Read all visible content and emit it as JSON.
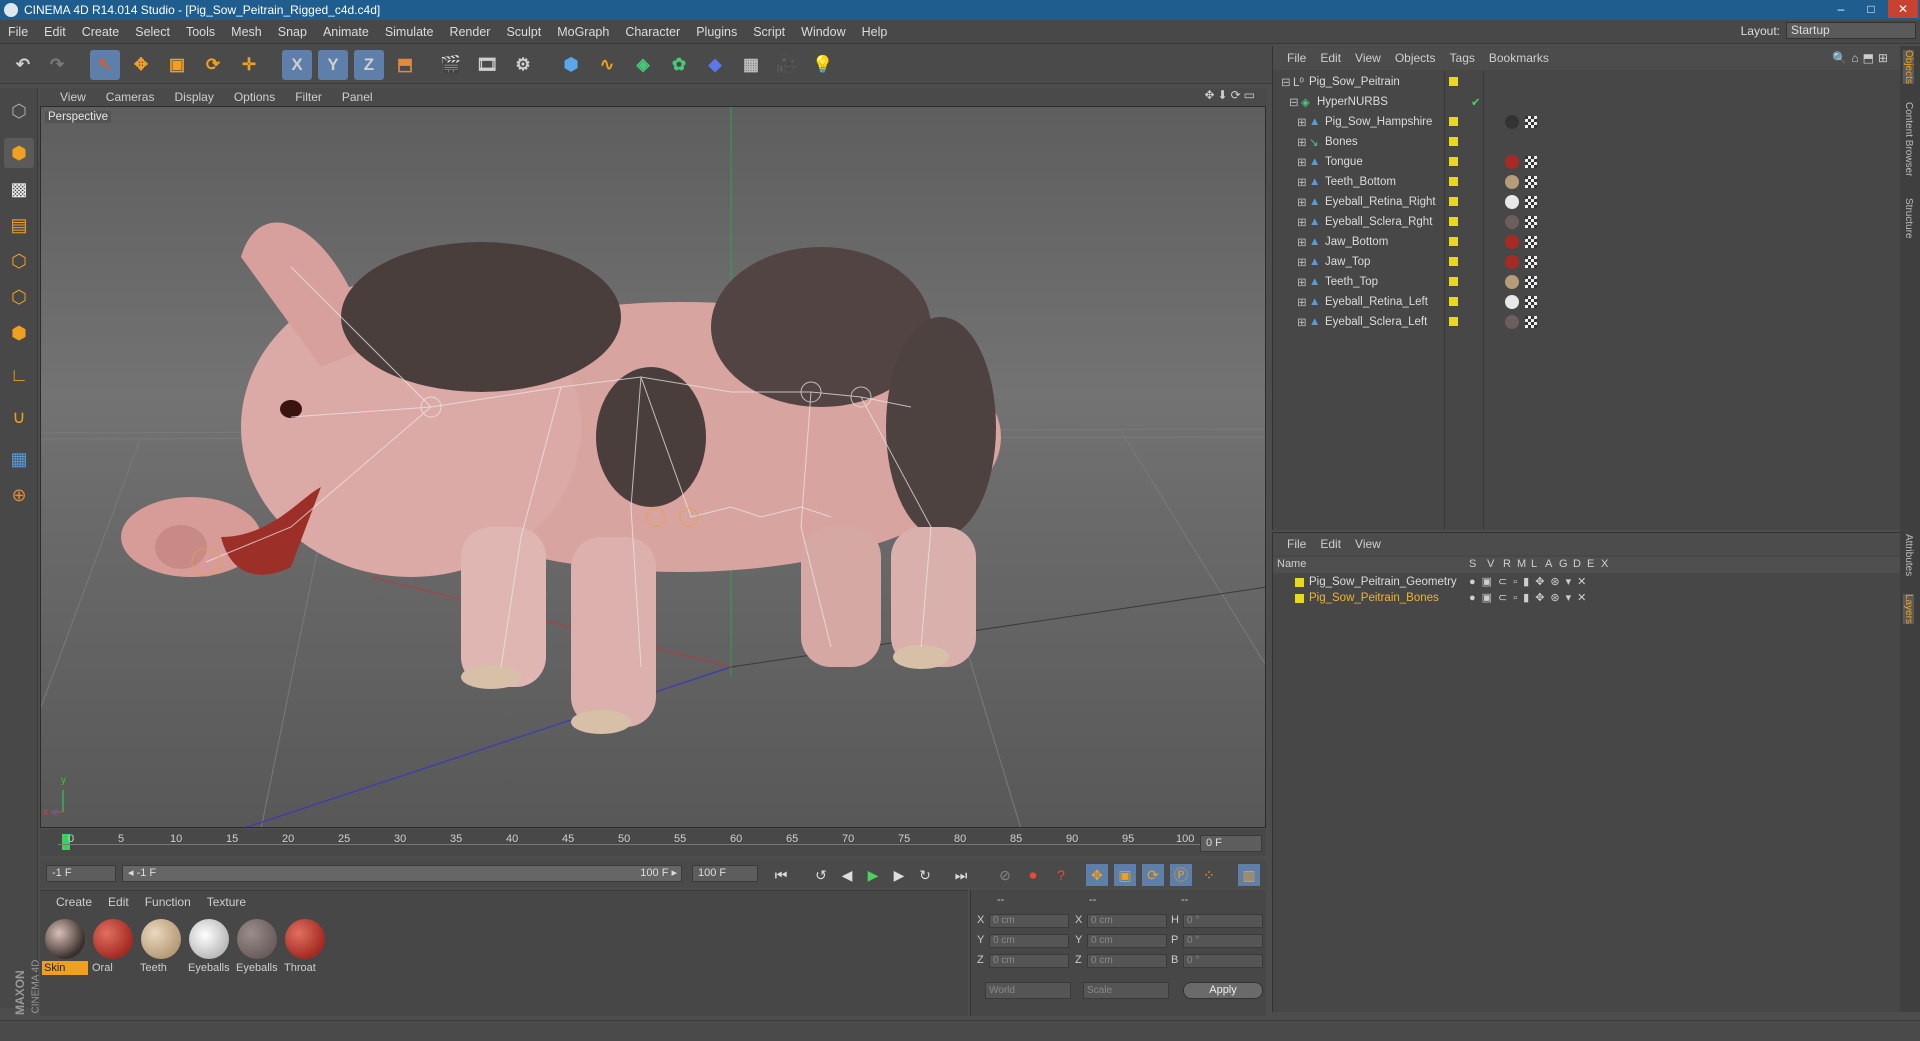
{
  "window": {
    "title": "CINEMA 4D R14.014 Studio - [Pig_Sow_Peitrain_Rigged_c4d.c4d]",
    "min": "–",
    "max": "□",
    "close": "✕"
  },
  "menu": [
    "File",
    "Edit",
    "Create",
    "Select",
    "Tools",
    "Mesh",
    "Snap",
    "Animate",
    "Simulate",
    "Render",
    "Sculpt",
    "MoGraph",
    "Character",
    "Plugins",
    "Script",
    "Window",
    "Help"
  ],
  "layout": {
    "label": "Layout:",
    "value": "Startup"
  },
  "toolbar": {
    "undo": "undo-icon",
    "redo": "redo-icon",
    "x": "X",
    "y": "Y",
    "z": "Z"
  },
  "viewport": {
    "menu": [
      "View",
      "Cameras",
      "Display",
      "Options",
      "Filter",
      "Panel"
    ],
    "label": "Perspective",
    "axes": {
      "x": "x",
      "y": "y",
      "z": "z"
    }
  },
  "timeline": {
    "ticks": [
      "0",
      "5",
      "10",
      "15",
      "20",
      "25",
      "30",
      "35",
      "40",
      "45",
      "50",
      "55",
      "60",
      "65",
      "70",
      "75",
      "80",
      "85",
      "90",
      "95",
      "100"
    ],
    "frame_field": "0 F"
  },
  "controls": {
    "start": "-1 F",
    "range_start": "◂ -1 F",
    "range_end": "100 F ▸",
    "end": "100 F"
  },
  "materials": {
    "menu": [
      "Create",
      "Edit",
      "Function",
      "Texture"
    ],
    "items": [
      {
        "name": "Skin",
        "color": "#3b2f2c",
        "selected": true
      },
      {
        "name": "Oral",
        "color": "#a52a23",
        "selected": false
      },
      {
        "name": "Teeth",
        "color": "#b79c79",
        "selected": false
      },
      {
        "name": "Eyeballs",
        "color": "#e8e8e8",
        "selected": false
      },
      {
        "name": "Eyeballs",
        "color": "#6b5e5c",
        "selected": false
      },
      {
        "name": "Throat",
        "color": "#a52a23",
        "selected": false
      }
    ],
    "brand_1": "MAXON",
    "brand_2": "CINEMA 4D"
  },
  "coords": {
    "headers": [
      "--",
      "--",
      "--"
    ],
    "rows": [
      {
        "a": "X",
        "av": "0 cm",
        "b": "X",
        "bv": "0 cm",
        "c": "H",
        "cv": "0 °"
      },
      {
        "a": "Y",
        "av": "0 cm",
        "b": "Y",
        "bv": "0 cm",
        "c": "P",
        "cv": "0 °"
      },
      {
        "a": "Z",
        "av": "0 cm",
        "b": "Z",
        "bv": "0 cm",
        "c": "B",
        "cv": "0 °"
      }
    ],
    "world": "World",
    "scale": "Scale",
    "apply": "Apply"
  },
  "objects": {
    "menu": [
      "File",
      "Edit",
      "View",
      "Objects",
      "Tags",
      "Bookmarks"
    ],
    "items": [
      {
        "name": "Pig_Sow_Peitrain",
        "indent": 0
      },
      {
        "name": "HyperNURBS",
        "indent": 1
      },
      {
        "name": "Pig_Sow_Hampshire",
        "indent": 2
      },
      {
        "name": "Bones",
        "indent": 2
      },
      {
        "name": "Tongue",
        "indent": 2
      },
      {
        "name": "Teeth_Bottom",
        "indent": 2
      },
      {
        "name": "Eyeball_Retina_Right",
        "indent": 2
      },
      {
        "name": "Eyeball_Sclera_Rght",
        "indent": 2
      },
      {
        "name": "Jaw_Bottom",
        "indent": 2
      },
      {
        "name": "Jaw_Top",
        "indent": 2
      },
      {
        "name": "Teeth_Top",
        "indent": 2
      },
      {
        "name": "Eyeball_Retina_Left",
        "indent": 2
      },
      {
        "name": "Eyeball_Sclera_Left",
        "indent": 2
      }
    ]
  },
  "layers": {
    "menu": [
      "File",
      "Edit",
      "View"
    ],
    "header": {
      "name": "Name",
      "cols": [
        "S",
        "V",
        "R",
        "M",
        "L",
        "A",
        "G",
        "D",
        "E",
        "X"
      ]
    },
    "items": [
      {
        "name": "Pig_Sow_Peitrain_Geometry",
        "color": "#dcdcdc"
      },
      {
        "name": "Pig_Sow_Peitrain_Bones",
        "color": "#f0b430"
      }
    ]
  },
  "side_tabs": [
    "Objects",
    "Content Browser",
    "Structure",
    "Attributes",
    "Layers"
  ]
}
